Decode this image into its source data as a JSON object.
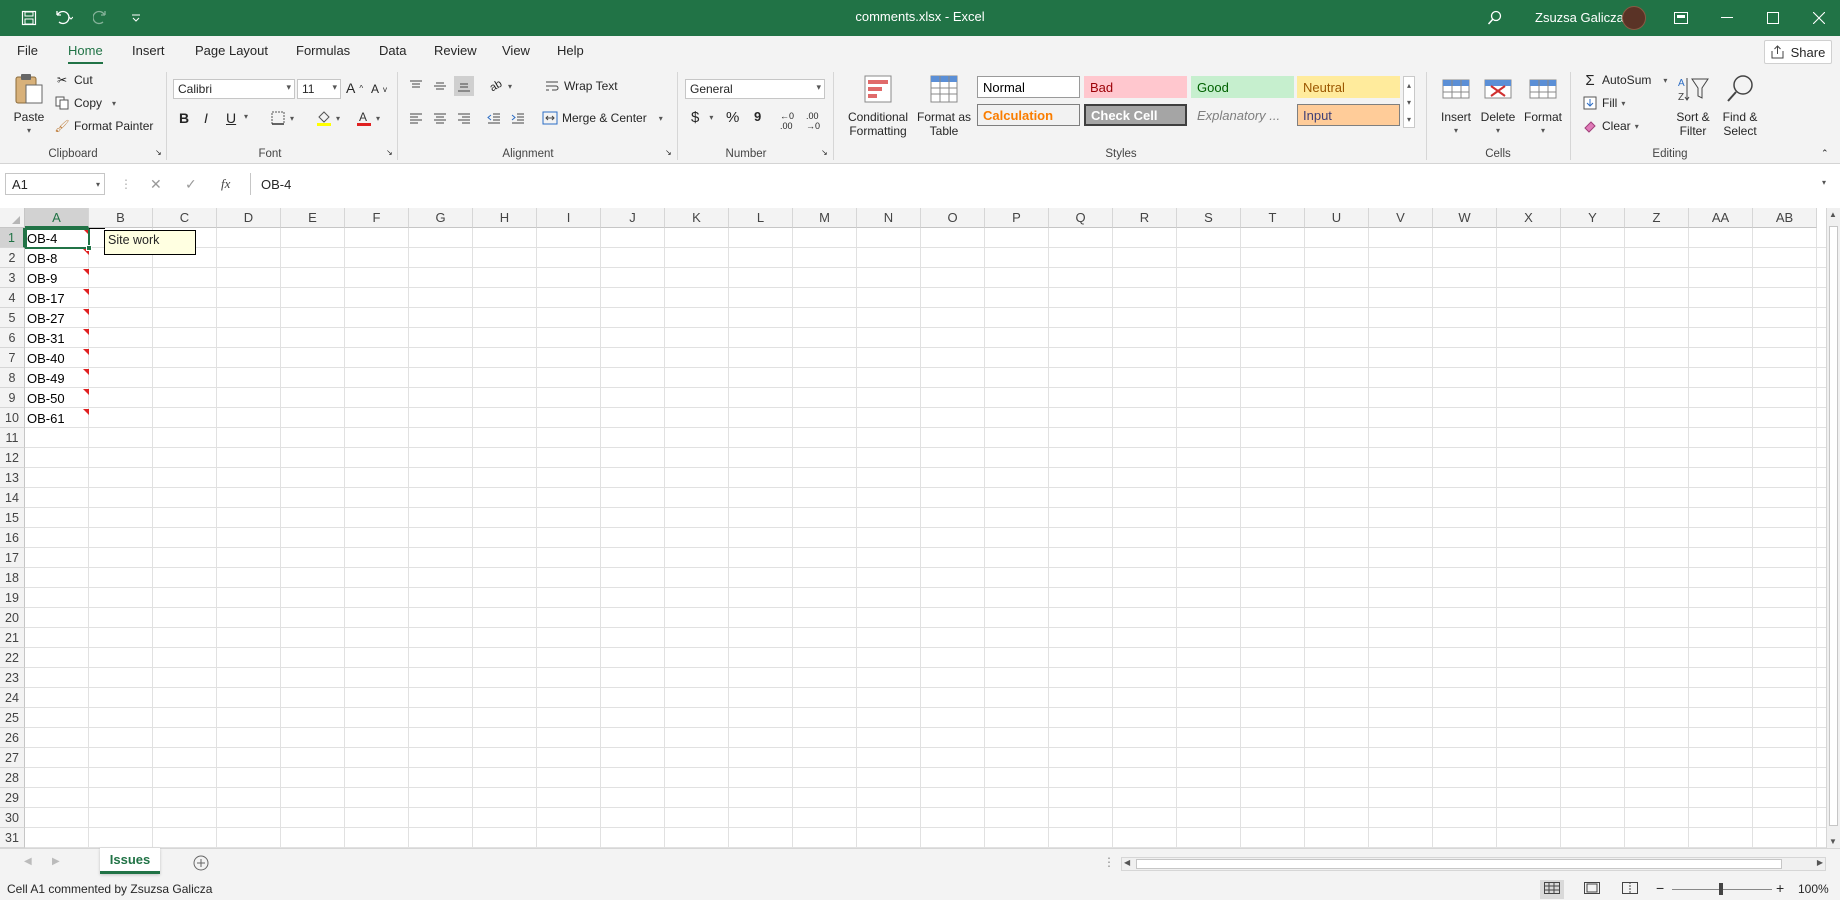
{
  "titlebar": {
    "title": "comments.xlsx  -  Excel",
    "user": "Zsuzsa Galicza",
    "bg_color": "#217346"
  },
  "menu": {
    "tabs": [
      "File",
      "Home",
      "Insert",
      "Page Layout",
      "Formulas",
      "Data",
      "Review",
      "View",
      "Help"
    ],
    "active": "Home",
    "share_label": "Share"
  },
  "ribbon": {
    "clipboard": {
      "paste": "Paste",
      "cut": "Cut",
      "copy": "Copy",
      "format_painter": "Format Painter",
      "group": "Clipboard"
    },
    "font": {
      "name": "Calibri",
      "size": "11",
      "bold": "B",
      "italic": "I",
      "underline": "U",
      "group": "Font"
    },
    "alignment": {
      "wrap_text": "Wrap Text",
      "merge_center": "Merge & Center",
      "group": "Alignment"
    },
    "number": {
      "format": "General",
      "currency": "$",
      "percent": "%",
      "comma": "9",
      "group": "Number"
    },
    "styles": {
      "conditional_formatting": "Conditional Formatting",
      "format_as_table": "Format as Table",
      "group": "Styles",
      "cells": [
        {
          "label": "Normal",
          "bg": "#ffffff",
          "fg": "#000000",
          "border": "#9a9a9a"
        },
        {
          "label": "Bad",
          "bg": "#ffc7ce",
          "fg": "#9c0006",
          "border": "#ffc7ce"
        },
        {
          "label": "Good",
          "bg": "#c6efce",
          "fg": "#006100",
          "border": "#c6efce"
        },
        {
          "label": "Neutral",
          "bg": "#ffeb9c",
          "fg": "#9c5700",
          "border": "#ffeb9c"
        },
        {
          "label": "Calculation",
          "bg": "#f2f2f2",
          "fg": "#fa7d00",
          "border": "#7f7f7f"
        },
        {
          "label": "Check Cell",
          "bg": "#a5a5a5",
          "fg": "#ffffff",
          "border": "#3f3f3f"
        },
        {
          "label": "Explanatory ...",
          "bg": "#f3f3f3",
          "fg": "#7f7f7f",
          "border": "#f3f3f3"
        },
        {
          "label": "Input",
          "bg": "#ffcc99",
          "fg": "#3f3f76",
          "border": "#7f7f7f"
        }
      ]
    },
    "cells": {
      "insert": "Insert",
      "delete": "Delete",
      "format": "Format",
      "group": "Cells"
    },
    "editing": {
      "autosum": "AutoSum",
      "fill": "Fill",
      "clear": "Clear",
      "sort_filter": "Sort & Filter",
      "find_select": "Find & Select",
      "group": "Editing"
    }
  },
  "formula_bar": {
    "name_box": "A1",
    "fx": "fx",
    "content": "OB-4"
  },
  "grid": {
    "columns": [
      "A",
      "B",
      "C",
      "D",
      "E",
      "F",
      "G",
      "H",
      "I",
      "J",
      "K",
      "L",
      "M",
      "N",
      "O",
      "P",
      "Q",
      "R",
      "S",
      "T",
      "U",
      "V",
      "W",
      "X",
      "Y",
      "Z",
      "AA",
      "AB"
    ],
    "rows": [
      "1",
      "2",
      "3",
      "4",
      "5",
      "6",
      "7",
      "8",
      "9",
      "10",
      "11",
      "12",
      "13",
      "14",
      "15",
      "16",
      "17",
      "18",
      "19",
      "20",
      "21",
      "22",
      "23",
      "24",
      "25",
      "26",
      "27",
      "28",
      "29",
      "30",
      "31"
    ],
    "col_a_values": [
      "OB-4",
      "OB-8",
      "OB-9",
      "OB-17",
      "OB-27",
      "OB-31",
      "OB-40",
      "OB-49",
      "OB-50",
      "OB-61"
    ],
    "selected_cell": "A1",
    "comment_text": "Site work"
  },
  "sheets": {
    "tabs": [
      "Issues"
    ],
    "active": "Issues"
  },
  "status": {
    "text": "Cell A1 commented by Zsuzsa Galicza",
    "zoom": "100%"
  }
}
